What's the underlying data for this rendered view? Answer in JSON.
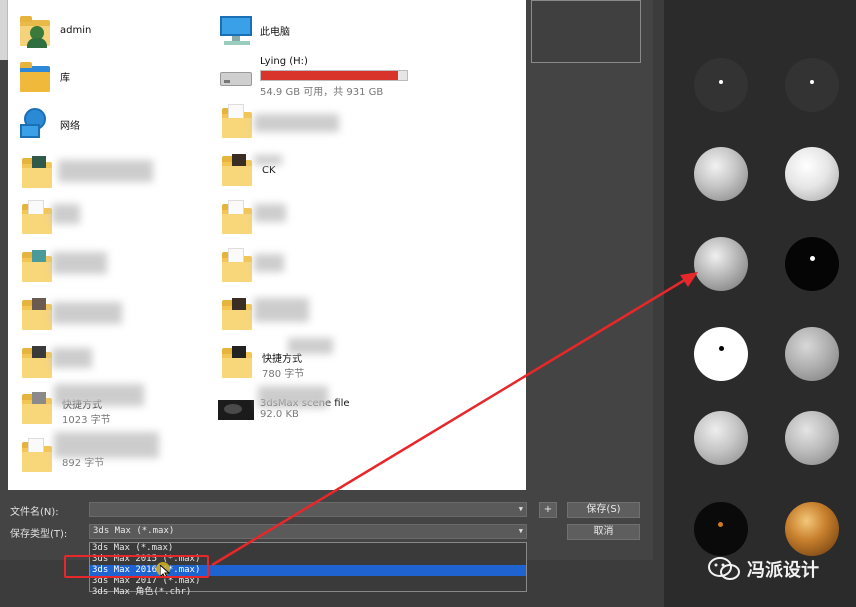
{
  "file_list": {
    "items": [
      {
        "name": "admin",
        "icon": "user-icon"
      },
      {
        "name": "此电脑",
        "icon": "this-pc-icon"
      },
      {
        "name": "库",
        "icon": "library-icon"
      },
      {
        "name": "Lying (H:)",
        "icon": "drive-icon",
        "detail": "54.9 GB 可用，共 931 GB",
        "used_fraction": 0.94
      },
      {
        "name": "网络",
        "icon": "network-icon"
      },
      {
        "name": "CK",
        "icon": "folder-icon"
      },
      {
        "name": "快捷方式",
        "icon": "folder-icon",
        "detail": "780 字节"
      },
      {
        "name": "快捷方式",
        "icon": "folder-icon",
        "detail": "1023 字节"
      },
      {
        "name": "3dsMax scene file",
        "icon": "max-file-icon",
        "detail": "92.0 KB"
      },
      {
        "name": "",
        "icon": "folder-icon",
        "detail": "892 字节"
      }
    ]
  },
  "save": {
    "filename_label": "文件名(N):",
    "filename_value": "",
    "type_label": "保存类型(T):",
    "type_value": "3ds Max (*.max)",
    "save_button": "保存(S)",
    "cancel_button": "取消",
    "plus_button": "+",
    "options": [
      "3ds Max (*.max)",
      "3ds Max 2015 (*.max)",
      "3ds Max 2016 (*.max)",
      "3ds Max 2017 (*.max)",
      "3ds Max 角色(*.chr)"
    ],
    "selected_option": 2
  },
  "watermark": {
    "text": "冯派设计"
  },
  "colors": {
    "accent": "#1e63d0",
    "annotation": "#e8272a",
    "drive_bar": "#d9342b"
  }
}
